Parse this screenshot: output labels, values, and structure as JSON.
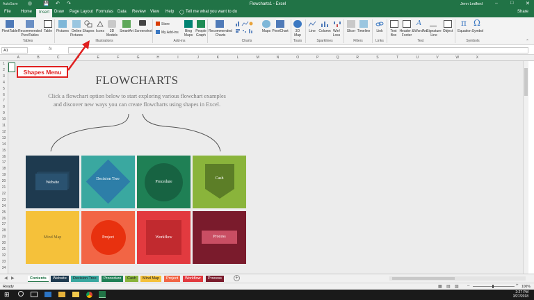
{
  "titlebar": {
    "autosave": "AutoSave",
    "title": "Flowcharts1 - Excel",
    "user": "Jenn Ledford"
  },
  "tabs": [
    "File",
    "Home",
    "Insert",
    "Draw",
    "Page Layout",
    "Formulas",
    "Data",
    "Review",
    "View",
    "Help"
  ],
  "tell_me": "Tell me what you want to do",
  "share": "Share",
  "ribbon": {
    "pivottable": "PivotTable",
    "recommended_pivottables": "Recommended PivotTables",
    "table": "Table",
    "pictures": "Pictures",
    "online_pictures": "Online Pictures",
    "shapes": "Shapes",
    "icons": "Icons",
    "models_3d": "3D Models",
    "smartart": "SmartArt",
    "screenshot": "Screenshot",
    "store": "Store",
    "my_addins": "My Add-ins",
    "bing_maps": "Bing Maps",
    "people_graph": "People Graph",
    "recommended_charts": "Recommended Charts",
    "maps": "Maps",
    "pivotchart": "PivotChart",
    "map_3d": "3D Map",
    "line": "Line",
    "column": "Column",
    "win_loss": "Win/ Loss",
    "slicer": "Slicer",
    "timeline": "Timeline",
    "link": "Link",
    "text_box": "Text Box",
    "header_footer": "Header & Footer",
    "wordart": "WordArt",
    "signature_line": "Signature Line",
    "object": "Object",
    "equation": "Equation",
    "symbol": "Symbol",
    "groups": {
      "tables": "Tables",
      "illustrations": "Illustrations",
      "addins": "Add-ins",
      "charts": "Charts",
      "tours": "Tours",
      "sparklines": "Sparklines",
      "filters": "Filters",
      "links": "Links",
      "text": "Text",
      "symbols": "Symbols"
    }
  },
  "formula_bar": {
    "name_box": "A1",
    "fx": "fx",
    "value": ""
  },
  "columns": [
    "A",
    "B",
    "C",
    "D",
    "E",
    "F",
    "G",
    "H",
    "I",
    "J",
    "K",
    "L",
    "M",
    "N",
    "O",
    "P",
    "Q",
    "R",
    "S",
    "T",
    "U",
    "V",
    "W",
    "X"
  ],
  "rows": [
    "1",
    "2",
    "3",
    "4",
    "5",
    "6",
    "7",
    "8",
    "9",
    "10",
    "11",
    "12",
    "13",
    "14",
    "15",
    "16",
    "17",
    "18",
    "19",
    "20",
    "21",
    "22",
    "23",
    "24",
    "25",
    "26",
    "27",
    "28",
    "29",
    "30",
    "31",
    "32",
    "33",
    "34"
  ],
  "callout": "Shapes Menu",
  "sheet": {
    "heading": "FLOWCHARTS",
    "intro_line1": "Click a flowchart option below to start exploring various flowchart examples",
    "intro_line2": "and discover new ways you can create flowcharts using shapes in Excel."
  },
  "tiles": [
    {
      "label": "Website",
      "bg": "#1e3a4f",
      "shape": "#2e5a7a"
    },
    {
      "label": "Decision Tree",
      "bg": "#3aa8a0",
      "shape": "#2d7ea8"
    },
    {
      "label": "Procedure",
      "bg": "#1f8055",
      "shape": "#176342"
    },
    {
      "label": "Cash",
      "bg": "#8ab43b",
      "shape": "#5c7e27"
    },
    {
      "label": "Mind Map",
      "bg": "#f5c13a",
      "shape": "#f5c13a"
    },
    {
      "label": "Project",
      "bg": "#f26545",
      "shape": "#e8310f"
    },
    {
      "label": "Workflow",
      "bg": "#e23a3f",
      "shape": "#c12a2f"
    },
    {
      "label": "Process",
      "bg": "#7a1b2c",
      "shape": "#c94e63"
    }
  ],
  "sheet_tabs": [
    {
      "label": "Contents",
      "color": "#ffffff",
      "text": "#217346"
    },
    {
      "label": "Website",
      "color": "#1e3a4f",
      "text": "#ffffff"
    },
    {
      "label": "Decision Tree",
      "color": "#3aa8a0",
      "text": "#222222"
    },
    {
      "label": "Procedure",
      "color": "#1f8055",
      "text": "#ffffff"
    },
    {
      "label": "Cash",
      "color": "#8ab43b",
      "text": "#222222"
    },
    {
      "label": "Mind Map",
      "color": "#f5c13a",
      "text": "#222222"
    },
    {
      "label": "Project",
      "color": "#f26545",
      "text": "#ffffff"
    },
    {
      "label": "Workflow",
      "color": "#e23a3f",
      "text": "#ffffff"
    },
    {
      "label": "Process",
      "color": "#7a1b2c",
      "text": "#ffffff"
    }
  ],
  "status": {
    "left": "Ready",
    "zoom": "100%"
  },
  "taskbar": {
    "time": "2:27 PM",
    "date": "3/27/2018"
  }
}
